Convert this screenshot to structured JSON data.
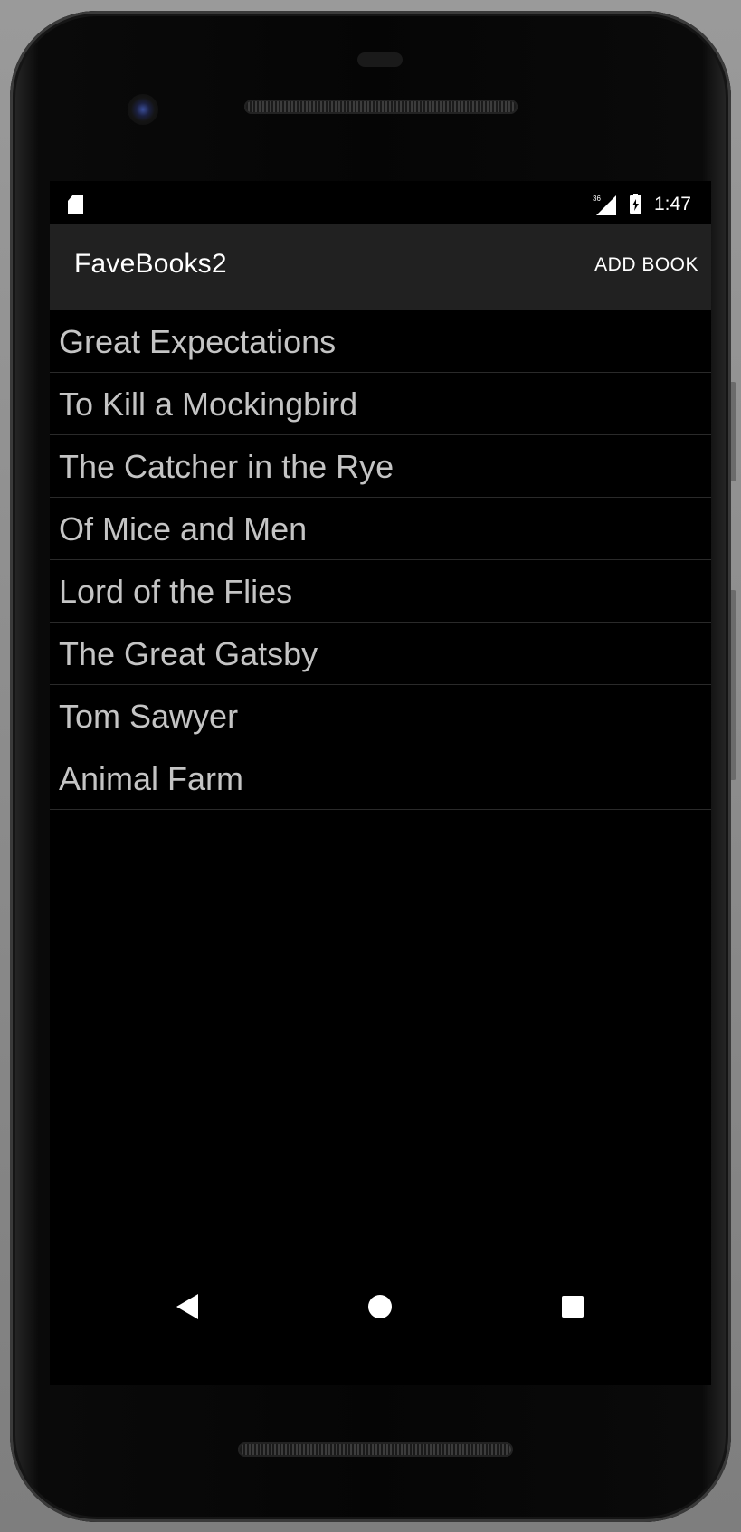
{
  "status_bar": {
    "network_label": "36",
    "time": "1:47"
  },
  "app_bar": {
    "title": "FaveBooks2",
    "add_button_label": "ADD BOOK"
  },
  "books": [
    "Great Expectations",
    "To Kill a Mockingbird",
    "The Catcher in the Rye",
    "Of Mice and Men",
    "Lord of the Flies",
    "The Great Gatsby",
    "Tom Sawyer",
    "Animal Farm"
  ],
  "colors": {
    "app_bar_background": "#212121",
    "screen_background": "#000000",
    "list_text": "#c4c4c4",
    "divider": "#2a2a2a"
  },
  "icons": {
    "status_left": "sd-card-icon",
    "signal": "cell-signal-icon",
    "battery": "battery-charging-icon",
    "nav_back": "back-triangle-icon",
    "nav_home": "home-circle-icon",
    "nav_recents": "recents-square-icon"
  }
}
